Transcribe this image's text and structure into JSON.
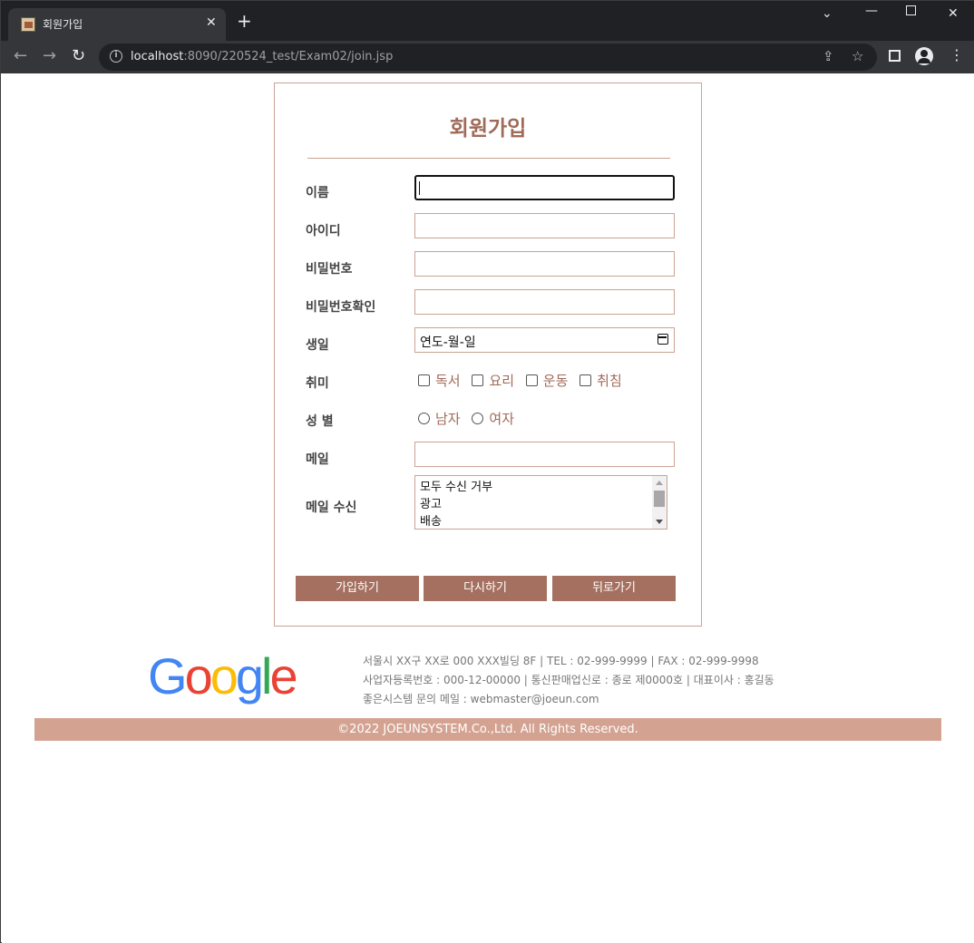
{
  "browser": {
    "tab_title": "회원가입",
    "url_host": "localhost",
    "url_rest": ":8090/220524_test/Exam02/join.jsp"
  },
  "form": {
    "title": "회원가입",
    "labels": {
      "name": "이름",
      "id": "아이디",
      "password": "비밀번호",
      "password_confirm": "비밀번호확인",
      "birthday": "생일",
      "hobby": "취미",
      "gender": "성 별",
      "email": "메일",
      "mail_receive": "메일 수신"
    },
    "birthday_placeholder": "연도-월-일",
    "hobbies": [
      "독서",
      "요리",
      "운동",
      "취침"
    ],
    "genders": [
      "남자",
      "여자"
    ],
    "mail_options": [
      "모두 수신 거부",
      "광고",
      "배송"
    ],
    "buttons": {
      "submit": "가입하기",
      "reset": "다시하기",
      "back": "뒤로가기"
    }
  },
  "footer": {
    "logo_letters": [
      "G",
      "o",
      "o",
      "g",
      "l",
      "e"
    ],
    "logo_colors": [
      "#4285F4",
      "#EA4335",
      "#FBBC05",
      "#4285F4",
      "#34A853",
      "#EA4335"
    ],
    "info_lines": [
      "서울시 XX구 XX로 000 XXX빌딩 8F | TEL : 02-999-9999 | FAX : 02-999-9998",
      "사업자등록번호 : 000-12-00000 | 통신판매업신로 : 종로 제0000호 | 대표이사 : 홍길동",
      "좋은시스템 문의 메일 : webmaster@joeun.com"
    ],
    "copyright": "©2022 JOEUNSYSTEM.Co.,Ltd. All Rights Reserved."
  },
  "colors": {
    "accent": "#a57060",
    "border": "#c9a393",
    "copyright_bg": "#d4a291"
  }
}
